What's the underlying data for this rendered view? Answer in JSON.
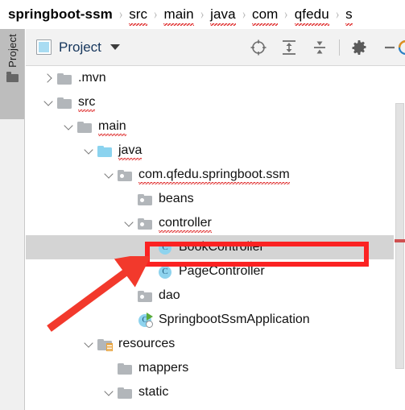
{
  "breadcrumb": {
    "name": "navigation-breadcrumb",
    "separator": "›",
    "items": [
      {
        "label": "springboot-ssm",
        "root": true,
        "spell": false
      },
      {
        "label": "src",
        "root": false,
        "spell": true
      },
      {
        "label": "main",
        "root": false,
        "spell": true
      },
      {
        "label": "java",
        "root": false,
        "spell": true
      },
      {
        "label": "com",
        "root": false,
        "spell": true
      },
      {
        "label": "qfedu",
        "root": false,
        "spell": true
      },
      {
        "label": "s",
        "root": false,
        "spell": true
      }
    ]
  },
  "left_strip": {
    "tab_label": "Project",
    "tab_icon": "folder-icon"
  },
  "toolbar": {
    "window_icon": "project-window-icon",
    "title": "Project",
    "caret_icon": "chevron-down-icon",
    "actions": [
      {
        "name": "locate-in-tree-icon",
        "tooltip": "Select Opened File"
      },
      {
        "name": "expand-all-icon",
        "tooltip": "Expand All"
      },
      {
        "name": "collapse-all-icon",
        "tooltip": "Collapse All"
      },
      {
        "name": "settings-gear-icon",
        "tooltip": "Settings"
      },
      {
        "name": "hide-window-icon",
        "tooltip": "Hide"
      },
      {
        "name": "inspection-status-icon",
        "tooltip": "Inspections"
      }
    ]
  },
  "tree": {
    "name": "project-tree",
    "rows": [
      {
        "label": ".mvn",
        "indent": 1,
        "twisty": "right",
        "icon": "folder",
        "spell": false,
        "selected": false
      },
      {
        "label": "src",
        "indent": 1,
        "twisty": "down",
        "icon": "folder",
        "spell": true,
        "selected": false
      },
      {
        "label": "main",
        "indent": 2,
        "twisty": "down",
        "icon": "folder",
        "spell": true,
        "selected": false
      },
      {
        "label": "java",
        "indent": 3,
        "twisty": "down",
        "icon": "folder-blue",
        "spell": true,
        "selected": false
      },
      {
        "label": "com.qfedu.springboot.ssm",
        "indent": 4,
        "twisty": "down",
        "icon": "package",
        "spell": true,
        "selected": false
      },
      {
        "label": "beans",
        "indent": 5,
        "twisty": "none",
        "icon": "package",
        "spell": false,
        "selected": false
      },
      {
        "label": "controller",
        "indent": 5,
        "twisty": "down",
        "icon": "package",
        "spell": true,
        "selected": false
      },
      {
        "label": "BookController",
        "indent": 6,
        "twisty": "none",
        "icon": "class",
        "spell": false,
        "selected": true
      },
      {
        "label": "PageController",
        "indent": 6,
        "twisty": "none",
        "icon": "class",
        "spell": false,
        "selected": false
      },
      {
        "label": "dao",
        "indent": 5,
        "twisty": "none",
        "icon": "package",
        "spell": false,
        "selected": false
      },
      {
        "label": "SpringbootSsmApplication",
        "indent": 5,
        "twisty": "none",
        "icon": "run-class",
        "spell": false,
        "selected": false
      },
      {
        "label": "resources",
        "indent": 3,
        "twisty": "down",
        "icon": "resources",
        "spell": false,
        "selected": false
      },
      {
        "label": "mappers",
        "indent": 4,
        "twisty": "none",
        "icon": "folder",
        "spell": false,
        "selected": false
      },
      {
        "label": "static",
        "indent": 4,
        "twisty": "down",
        "icon": "folder",
        "spell": false,
        "selected": false
      }
    ]
  },
  "scrollbar": {
    "name": "tree-vertical-scrollbar",
    "error_marker_color": "#cf5050"
  },
  "annotations": {
    "highlight_rect": {
      "name": "red-highlight-rectangle",
      "color": "#fb2222"
    },
    "arrow": {
      "name": "red-pointer-arrow",
      "color": "#f2392c"
    }
  }
}
